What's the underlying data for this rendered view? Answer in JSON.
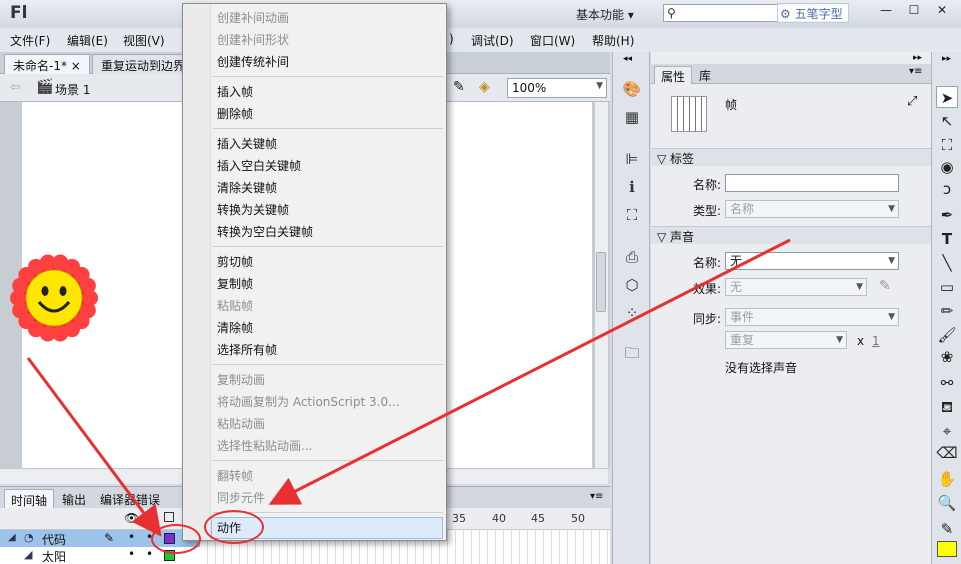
{
  "window": {
    "app_logo": "Fl",
    "workspace": "基本功能 ▾",
    "watermark": "五笔字型"
  },
  "menu": [
    "文件(F)",
    "编辑(E)",
    "视图(V)",
    "调试(D)",
    "窗口(W)",
    "帮助(H)"
  ],
  "menu_partial": ")",
  "doc_tabs": [
    {
      "label": "未命名-1* ×"
    },
    {
      "label": "重复运动到边界"
    }
  ],
  "editbar": {
    "scene": "场景 1",
    "zoom": "100%"
  },
  "timeline": {
    "tabs": [
      "时间轴",
      "输出",
      "编译器错误"
    ],
    "frame_numbers": [
      "35",
      "40",
      "45",
      "50"
    ],
    "layers": [
      {
        "name": "代码"
      },
      {
        "name": "太阳"
      }
    ]
  },
  "properties": {
    "tabs": [
      "属性",
      "库"
    ],
    "frame_title": "帧",
    "label_section": "标签",
    "name_label": "名称:",
    "name_value": "",
    "type_label": "类型:",
    "type_value": "名称",
    "sound_section": "声音",
    "sound_name_label": "名称:",
    "sound_name_value": "无",
    "effect_label": "效果:",
    "effect_value": "无",
    "sync_label": "同步:",
    "sync_value": "事件",
    "repeat_value": "重复",
    "repeat_x": "x",
    "repeat_count": "1",
    "no_sound": "没有选择声音"
  },
  "context_menu": {
    "groups": [
      [
        {
          "label": "创建补间动画",
          "enabled": false
        },
        {
          "label": "创建补间形状",
          "enabled": false
        },
        {
          "label": "创建传统补间",
          "enabled": true
        }
      ],
      [
        {
          "label": "插入帧",
          "enabled": true
        },
        {
          "label": "删除帧",
          "enabled": true
        }
      ],
      [
        {
          "label": "插入关键帧",
          "enabled": true
        },
        {
          "label": "插入空白关键帧",
          "enabled": true
        },
        {
          "label": "清除关键帧",
          "enabled": true
        },
        {
          "label": "转换为关键帧",
          "enabled": true
        },
        {
          "label": "转换为空白关键帧",
          "enabled": true
        }
      ],
      [
        {
          "label": "剪切帧",
          "enabled": true
        },
        {
          "label": "复制帧",
          "enabled": true
        },
        {
          "label": "粘贴帧",
          "enabled": false
        },
        {
          "label": "清除帧",
          "enabled": true
        },
        {
          "label": "选择所有帧",
          "enabled": true
        }
      ],
      [
        {
          "label": "复制动画",
          "enabled": false
        },
        {
          "label": "将动画复制为 ActionScript 3.0...",
          "enabled": false
        },
        {
          "label": "粘贴动画",
          "enabled": false
        },
        {
          "label": "选择性粘贴动画...",
          "enabled": false
        }
      ],
      [
        {
          "label": "翻转帧",
          "enabled": false
        },
        {
          "label": "同步元件",
          "enabled": false
        }
      ],
      [
        {
          "label": "动作",
          "enabled": true
        }
      ]
    ]
  },
  "colors": {
    "accent_red": "#e83030",
    "fill_yellow": "#ffff00",
    "layer_selected": "#9cc3ea"
  }
}
